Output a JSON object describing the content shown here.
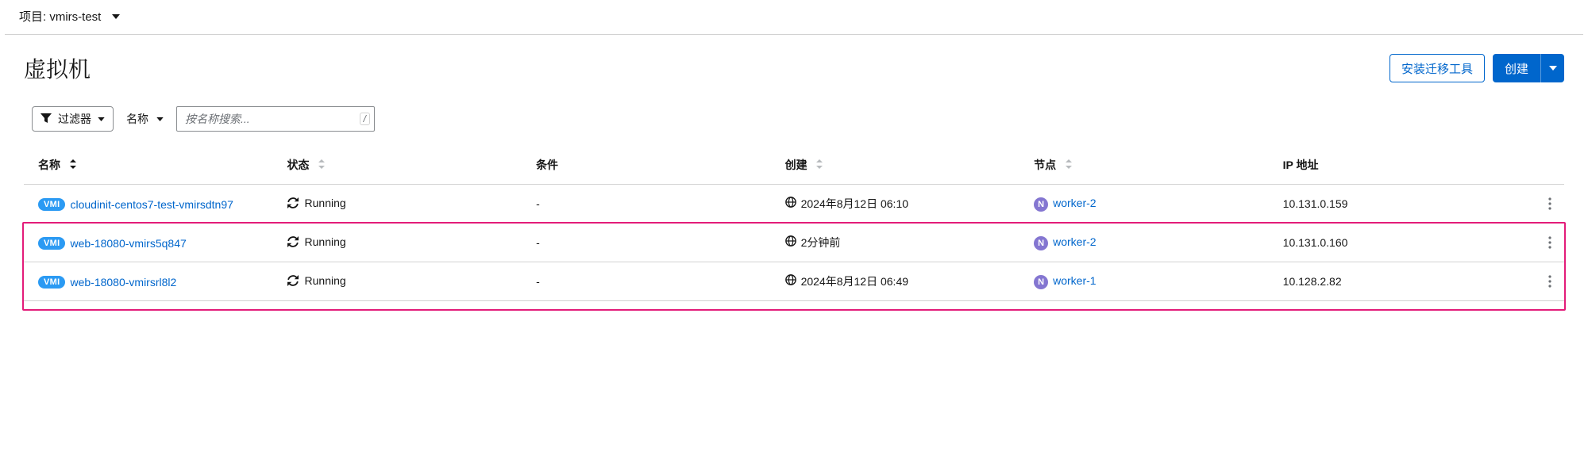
{
  "project_bar": {
    "label": "项目: vmirs-test"
  },
  "page": {
    "title": "虚拟机"
  },
  "actions": {
    "migrate_tool": "安装迁移工具",
    "create": "创建"
  },
  "toolbar": {
    "filter_label": "过滤器",
    "filter_by_label": "名称",
    "search_placeholder": "按名称搜索...",
    "search_kbd": "/"
  },
  "table": {
    "columns": {
      "name": "名称",
      "status": "状态",
      "condition": "条件",
      "created": "创建",
      "node": "节点",
      "ip": "IP 地址"
    },
    "badge_vmi": "VMI",
    "node_badge": "N",
    "rows": [
      {
        "name": "cloudinit-centos7-test-vmirsdtn97",
        "status": "Running",
        "condition": "-",
        "created": "2024年8月12日 06:10",
        "node": "worker-2",
        "ip": "10.131.0.159"
      },
      {
        "name": "web-18080-vmirs5q847",
        "status": "Running",
        "condition": "-",
        "created": "2分钟前",
        "node": "worker-2",
        "ip": "10.131.0.160"
      },
      {
        "name": "web-18080-vmirsrl8l2",
        "status": "Running",
        "condition": "-",
        "created": "2024年8月12日 06:49",
        "node": "worker-1",
        "ip": "10.128.2.82"
      }
    ]
  }
}
